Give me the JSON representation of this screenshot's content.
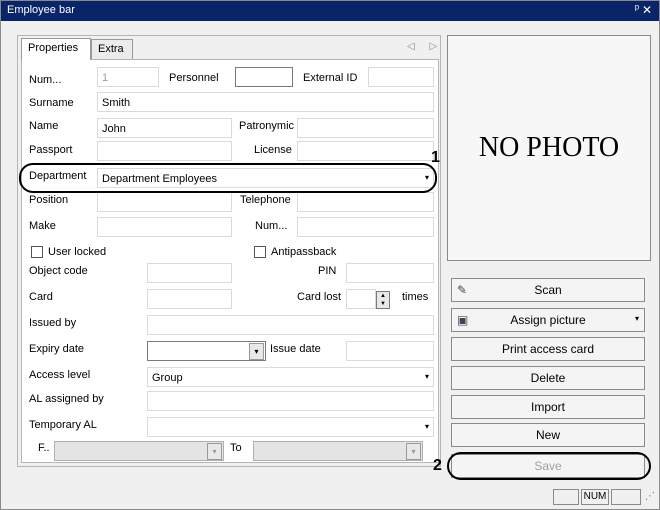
{
  "window": {
    "title": "Employee bar",
    "pin_glyph": "ᵖ",
    "close_glyph": "✕"
  },
  "tabs": [
    {
      "label": "Properties",
      "active": true
    },
    {
      "label": "Extra",
      "active": false
    }
  ],
  "tab_scroll_glyphs": "◁ ▷",
  "form": {
    "num_label": "Num...",
    "num_value": "1",
    "personnel_label": "Personnel",
    "personnel_value": "",
    "external_id_label": "External ID",
    "external_id_value": "",
    "surname_label": "Surname",
    "surname_value": "Smith",
    "name_label": "Name",
    "name_value": "John",
    "patronymic_label": "Patronymic",
    "patronymic_value": "",
    "passport_label": "Passport",
    "passport_value": "",
    "license_label": "License",
    "license_value": "",
    "department_label": "Department",
    "department_value": "Department Employees",
    "position_label": "Position",
    "position_value": "",
    "telephone_label": "Telephone",
    "telephone_value": "",
    "make_label": "Make",
    "make_value": "",
    "num2_label": "Num...",
    "num2_value": "",
    "user_locked_label": "User locked",
    "user_locked_checked": false,
    "antipassback_label": "Antipassback",
    "antipassback_checked": false,
    "object_code_label": "Object code",
    "object_code_value": "",
    "pin_label": "PIN",
    "pin_value": "",
    "card_label": "Card",
    "card_value": "",
    "card_lost_label": "Card lost",
    "card_lost_value": "",
    "times_label": "times",
    "issued_by_label": "Issued by",
    "issued_by_value": "",
    "expiry_date_label": "Expiry date",
    "expiry_date_value": "",
    "issue_date_label": "Issue date",
    "issue_date_value": "",
    "access_level_label": "Access level",
    "access_level_value": "Group",
    "al_assigned_by_label": "AL assigned by",
    "al_assigned_by_value": "",
    "temporary_al_label": "Temporary AL",
    "temporary_al_value": "",
    "from_label": "F..",
    "from_value": "",
    "to_label": "To",
    "to_value": ""
  },
  "photo": {
    "placeholder": "NO PHOTO"
  },
  "buttons": {
    "scan": "Scan",
    "assign_picture": "Assign picture",
    "print_access_card": "Print access card",
    "delete": "Delete",
    "import": "Import",
    "new": "New",
    "save": "Save"
  },
  "callouts": {
    "one": "1",
    "two": "2"
  },
  "statusbar": {
    "cell1": "",
    "cell2": "NUM",
    "cell3": ""
  },
  "icons": {
    "dropdown": "▾",
    "spin_up": "▲",
    "spin_down": "▼",
    "grip": "⋰",
    "scan_icon": "✎",
    "camera_icon": "▣"
  }
}
